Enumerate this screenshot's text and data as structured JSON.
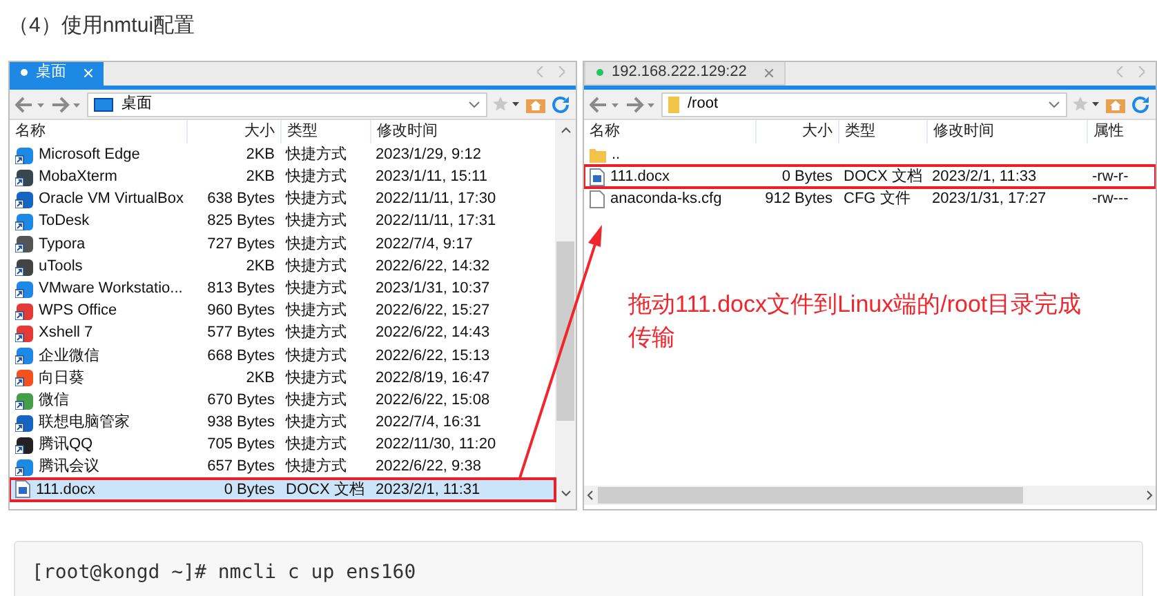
{
  "heading": "（4）使用nmtui配置",
  "panels": [
    {
      "kind": "local",
      "tab": {
        "label": "桌面",
        "color": "#ffffff",
        "focused": true
      },
      "path": "桌面",
      "columns": [
        "名称",
        "大小",
        "类型",
        "修改时间"
      ],
      "rows": [
        {
          "kind": "shortcut",
          "name": "Microsoft Edge",
          "size": "2KB",
          "type": "快捷方式",
          "modified": "2023/1/29, 9:12",
          "selected": false,
          "highlighted": false
        },
        {
          "kind": "shortcut",
          "name": "MobaXterm",
          "size": "2KB",
          "type": "快捷方式",
          "modified": "2023/1/11, 15:11",
          "selected": false,
          "highlighted": false
        },
        {
          "kind": "shortcut",
          "name": "Oracle VM VirtualBox",
          "size": "638 Bytes",
          "type": "快捷方式",
          "modified": "2022/11/11, 17:30",
          "selected": false,
          "highlighted": false
        },
        {
          "kind": "shortcut",
          "name": "ToDesk",
          "size": "825 Bytes",
          "type": "快捷方式",
          "modified": "2022/11/11, 17:31",
          "selected": false,
          "highlighted": false
        },
        {
          "kind": "shortcut",
          "name": "Typora",
          "size": "727 Bytes",
          "type": "快捷方式",
          "modified": "2022/7/4, 9:17",
          "selected": false,
          "highlighted": false
        },
        {
          "kind": "shortcut",
          "name": "uTools",
          "size": "2KB",
          "type": "快捷方式",
          "modified": "2022/6/22, 14:32",
          "selected": false,
          "highlighted": false
        },
        {
          "kind": "shortcut",
          "name": "VMware Workstatio...",
          "size": "813 Bytes",
          "type": "快捷方式",
          "modified": "2023/1/31, 10:37",
          "selected": false,
          "highlighted": false
        },
        {
          "kind": "shortcut",
          "name": "WPS Office",
          "size": "960 Bytes",
          "type": "快捷方式",
          "modified": "2022/6/22, 15:27",
          "selected": false,
          "highlighted": false
        },
        {
          "kind": "shortcut",
          "name": "Xshell 7",
          "size": "577 Bytes",
          "type": "快捷方式",
          "modified": "2022/6/22, 14:43",
          "selected": false,
          "highlighted": false
        },
        {
          "kind": "shortcut",
          "name": "企业微信",
          "size": "668 Bytes",
          "type": "快捷方式",
          "modified": "2022/6/22, 15:13",
          "selected": false,
          "highlighted": false
        },
        {
          "kind": "shortcut",
          "name": "向日葵",
          "size": "2KB",
          "type": "快捷方式",
          "modified": "2022/8/19, 16:47",
          "selected": false,
          "highlighted": false
        },
        {
          "kind": "shortcut",
          "name": "微信",
          "size": "670 Bytes",
          "type": "快捷方式",
          "modified": "2022/6/22, 15:08",
          "selected": false,
          "highlighted": false
        },
        {
          "kind": "shortcut",
          "name": "联想电脑管家",
          "size": "938 Bytes",
          "type": "快捷方式",
          "modified": "2022/7/4, 16:31",
          "selected": false,
          "highlighted": false
        },
        {
          "kind": "shortcut",
          "name": "腾讯QQ",
          "size": "705 Bytes",
          "type": "快捷方式",
          "modified": "2022/11/30, 11:20",
          "selected": false,
          "highlighted": false
        },
        {
          "kind": "shortcut",
          "name": "腾讯会议",
          "size": "657 Bytes",
          "type": "快捷方式",
          "modified": "2022/6/22, 9:38",
          "selected": false,
          "highlighted": false
        },
        {
          "kind": "document",
          "name": "111.docx",
          "size": "0 Bytes",
          "type": "DOCX 文档",
          "modified": "2023/2/1, 11:31",
          "selected": true,
          "highlighted": true
        }
      ]
    },
    {
      "kind": "remote",
      "tab": {
        "label": "192.168.222.129:22",
        "color": "#22c55e",
        "focused": false
      },
      "path": "/root",
      "columns": [
        "名称",
        "大小",
        "类型",
        "修改时间",
        "属性"
      ],
      "rows": [
        {
          "kind": "folder",
          "name": "..",
          "selected": false,
          "highlighted": false
        },
        {
          "kind": "document",
          "name": "111.docx",
          "size": "0 Bytes",
          "type": "DOCX 文档",
          "modified": "2023/2/1, 11:33",
          "attrs": "-rw-r-",
          "selected": false,
          "highlighted": true
        },
        {
          "kind": "file",
          "name": "anaconda-ks.cfg",
          "size": "912 Bytes",
          "type": "CFG 文件",
          "modified": "2023/1/31, 17:27",
          "attrs": "-rw---",
          "selected": false,
          "highlighted": false
        }
      ],
      "annotation": "拖动111.docx文件到Linux端的/root目录完成传输"
    }
  ],
  "code": "[root@kongd ~]# nmcli c up ens160"
}
